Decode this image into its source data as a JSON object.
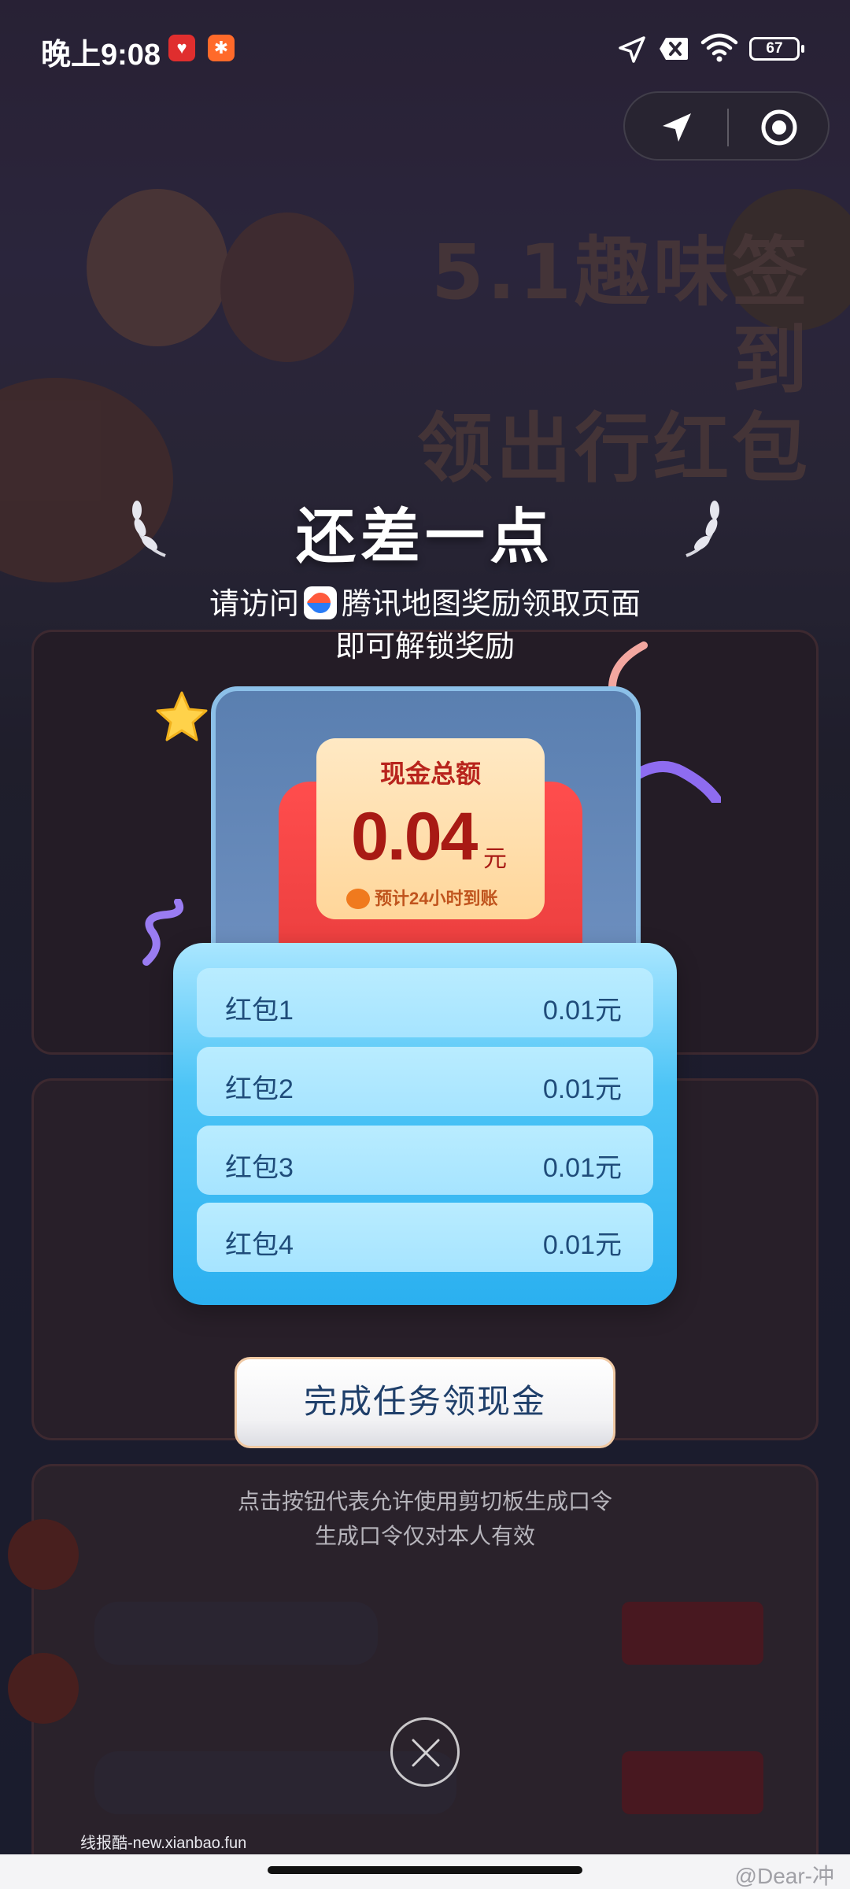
{
  "status_bar": {
    "time": "晚上9:08",
    "battery": "67",
    "icons": [
      "heart-app-icon",
      "runner-app-icon",
      "location-arrow-icon",
      "sim-off-icon",
      "wifi-icon",
      "battery-icon"
    ]
  },
  "map_controls": {
    "icons": [
      "navigate-icon",
      "locate-target-icon"
    ]
  },
  "background": {
    "banner_title_line1": "5.1趣味签到",
    "banner_title_line2": "领出行红包"
  },
  "dialog": {
    "title": "还差一点",
    "subtitle_prefix": "请访问",
    "subtitle_app": "腾讯地图奖励领取页面",
    "subtitle_line2": "即可解锁奖励",
    "cash": {
      "label": "现金总额",
      "amount": "0.04",
      "unit": "元",
      "note": "预计24小时到账"
    },
    "packets": [
      {
        "name": "红包1",
        "value": "0.01元"
      },
      {
        "name": "红包2",
        "value": "0.01元"
      },
      {
        "name": "红包3",
        "value": "0.01元"
      },
      {
        "name": "红包4",
        "value": "0.01元"
      }
    ],
    "cta_label": "完成任务领现金",
    "hint_line1": "点击按钮代表允许使用剪切板生成口令",
    "hint_line2": "生成口令仅对本人有效"
  },
  "watermarks": {
    "left": "线报酷-new.xianbao.fun",
    "right": "@Dear-冲"
  },
  "colors": {
    "cash_text": "#a81a14",
    "packet_panel": "#2bb0f0",
    "cta_text": "#1f3f6a"
  }
}
